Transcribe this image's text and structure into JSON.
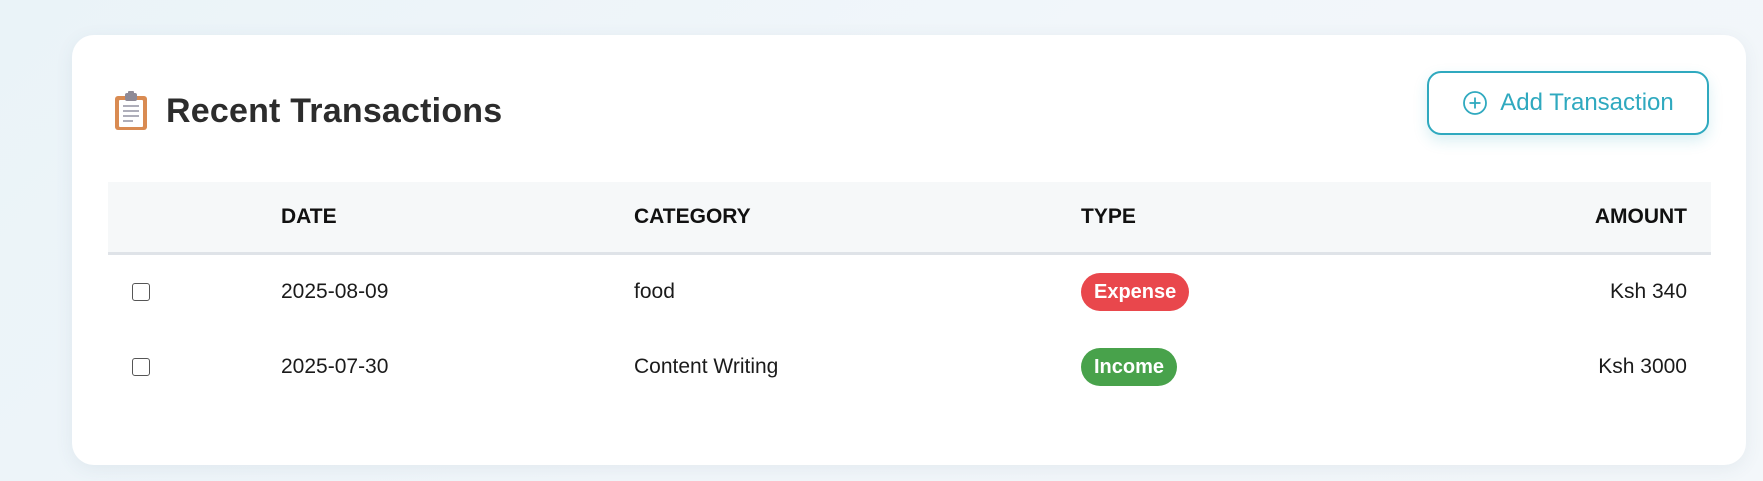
{
  "header": {
    "title": "Recent Transactions",
    "title_icon": "clipboard-icon",
    "add_button_label": "Add Transaction",
    "add_button_icon": "plus-circle-icon"
  },
  "table": {
    "columns": {
      "date": "DATE",
      "category": "CATEGORY",
      "type": "TYPE",
      "amount": "AMOUNT"
    },
    "rows": [
      {
        "selected": false,
        "date": "2025-08-09",
        "category": "food",
        "type": "Expense",
        "type_color": "#e9474c",
        "amount": "Ksh 340"
      },
      {
        "selected": false,
        "date": "2025-07-30",
        "category": "Content Writing",
        "type": "Income",
        "type_color": "#48a24b",
        "amount": "Ksh 3000"
      }
    ]
  },
  "colors": {
    "accent": "#2fa9bf",
    "expense": "#e9474c",
    "income": "#48a24b"
  }
}
